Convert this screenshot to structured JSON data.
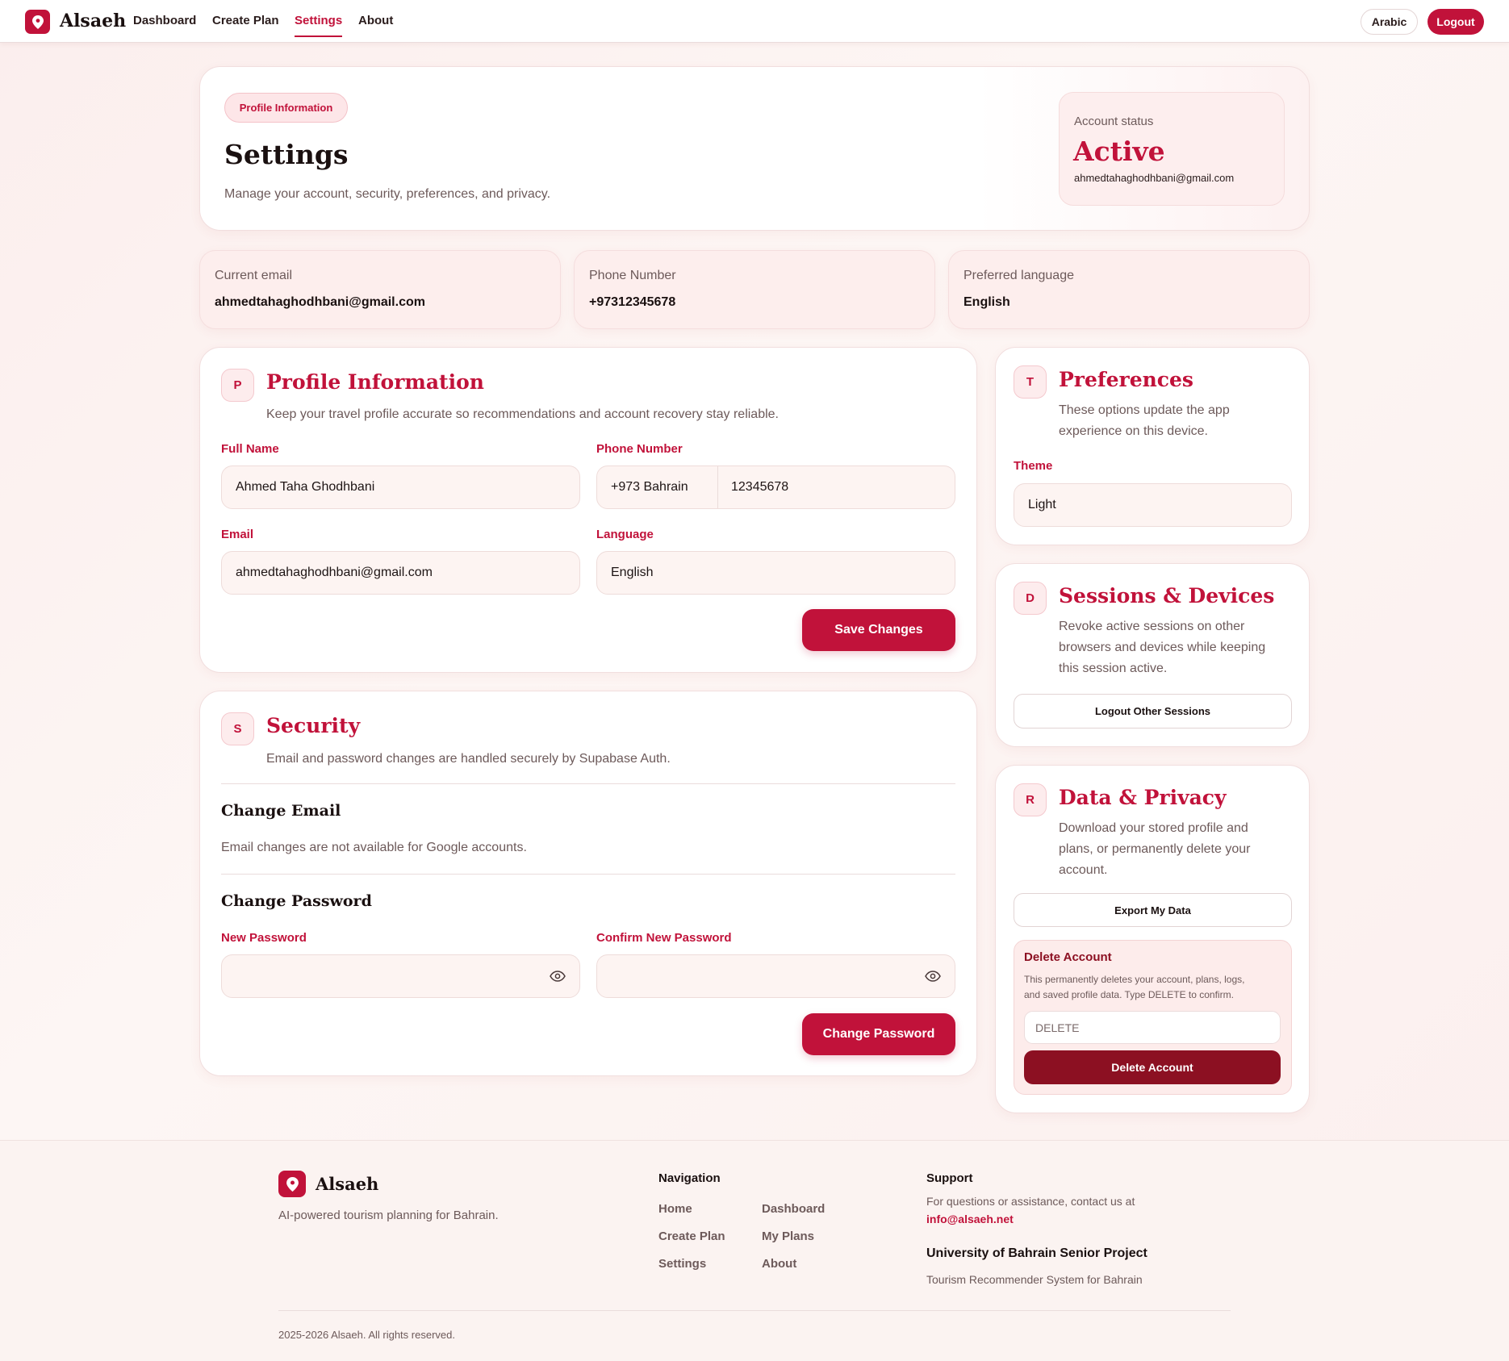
{
  "nav": {
    "brand": "Alsaeh",
    "links": [
      "Dashboard",
      "Create Plan",
      "Settings",
      "About"
    ],
    "active": "Settings",
    "language_button": "Arabic",
    "logout_button": "Logout"
  },
  "hero": {
    "pill": "Profile Information",
    "title": "Settings",
    "subtitle": "Manage your account, security, preferences, and privacy.",
    "status_label": "Account status",
    "status_value": "Active",
    "status_email": "ahmedtahaghodhbani@gmail.com"
  },
  "info_cards": [
    {
      "label": "Current email",
      "value": "ahmedtahaghodhbani@gmail.com"
    },
    {
      "label": "Phone Number",
      "value": "+97312345678"
    },
    {
      "label": "Preferred language",
      "value": "English"
    }
  ],
  "profile": {
    "badge": "P",
    "title": "Profile Information",
    "description": "Keep your travel profile accurate so recommendations and account recovery stay reliable.",
    "full_name_label": "Full Name",
    "full_name_value": "Ahmed Taha Ghodhbani",
    "phone_label": "Phone Number",
    "phone_country": "+973 Bahrain",
    "phone_value": "12345678",
    "email_label": "Email",
    "email_value": "ahmedtahaghodhbani@gmail.com",
    "language_label": "Language",
    "language_value": "English",
    "save_button": "Save Changes"
  },
  "security": {
    "badge": "S",
    "title": "Security",
    "description": "Email and password changes are handled securely by Supabase Auth.",
    "change_email_title": "Change Email",
    "change_email_note": "Email changes are not available for Google accounts.",
    "change_password_title": "Change Password",
    "new_password_label": "New Password",
    "confirm_password_label": "Confirm New Password",
    "change_password_button": "Change Password"
  },
  "preferences": {
    "badge": "T",
    "title": "Preferences",
    "description_line1": "These options update the app",
    "description_line2": "experience on this device.",
    "theme_label": "Theme",
    "theme_value": "Light"
  },
  "sessions": {
    "badge": "D",
    "title": "Sessions & Devices",
    "description_line1": "Revoke active sessions on other",
    "description_line2": "browsers and devices while keeping",
    "description_line3": "this session active.",
    "button": "Logout Other Sessions"
  },
  "privacy": {
    "badge": "R",
    "title": "Data & Privacy",
    "description_line1": "Download your stored profile and",
    "description_line2": "plans, or permanently delete your",
    "description_line3": "account.",
    "export_button": "Export My Data",
    "delete_title": "Delete Account",
    "delete_text_line1": "This permanently deletes your account, plans, logs,",
    "delete_text_line2": "and saved profile data. Type DELETE to confirm.",
    "delete_placeholder": "DELETE",
    "delete_button": "Delete Account"
  },
  "footer": {
    "brand": "Alsaeh",
    "tagline": "AI-powered tourism planning for Bahrain.",
    "nav_heading": "Navigation",
    "nav_links": [
      "Home",
      "Dashboard",
      "Create Plan",
      "My Plans",
      "Settings",
      "About"
    ],
    "support_heading": "Support",
    "support_text": "For questions or assistance, contact us at",
    "support_email": "info@alsaeh.net",
    "project_title": "University of Bahrain Senior Project",
    "project_subtitle": "Tourism Recommender System for Bahrain",
    "copyright": "2025-2026 Alsaeh. All rights reserved."
  },
  "colors": {
    "accent": "#c1123a",
    "danger": "#8c1022",
    "background": "#fbf1ef"
  },
  "icons": [
    "map-pin-icon",
    "eye-icon"
  ]
}
